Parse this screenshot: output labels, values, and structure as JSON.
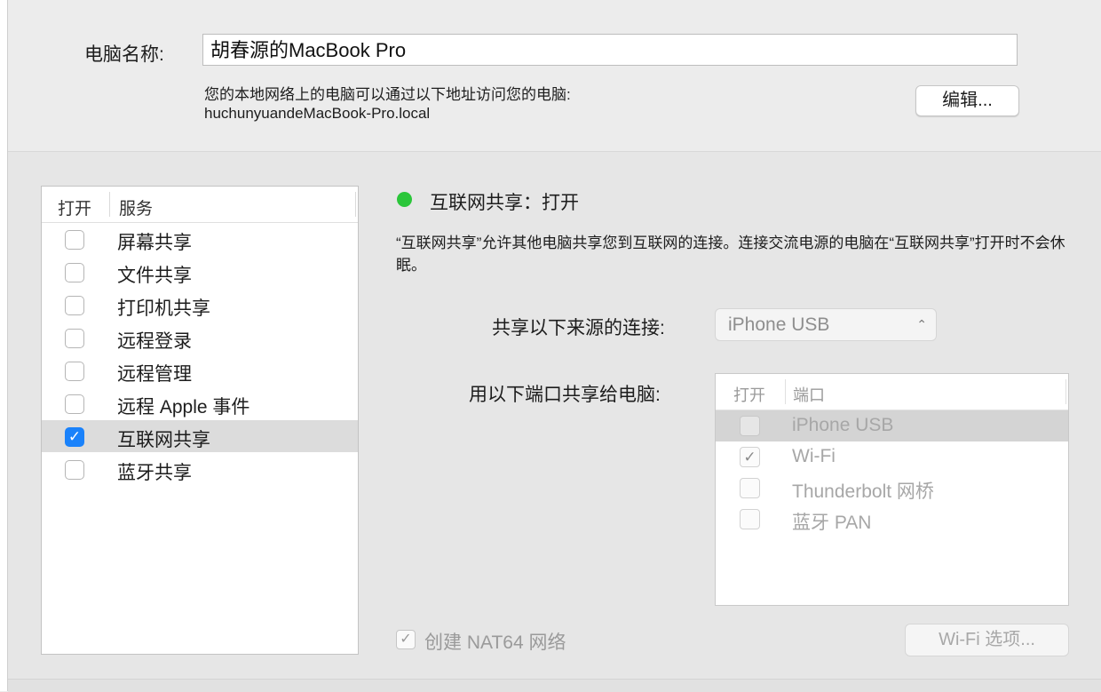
{
  "computer_name": {
    "label": "电脑名称:",
    "value": "胡春源的MacBook Pro",
    "info_line1": "您的本地网络上的电脑可以通过以下地址访问您的电脑:",
    "info_line2": "huchunyuandeMacBook-Pro.local",
    "edit_button": "编辑..."
  },
  "services": {
    "header_on": "打开",
    "header_service": "服务",
    "items": [
      {
        "label": "屏幕共享",
        "checked": false
      },
      {
        "label": "文件共享",
        "checked": false
      },
      {
        "label": "打印机共享",
        "checked": false
      },
      {
        "label": "远程登录",
        "checked": false
      },
      {
        "label": "远程管理",
        "checked": false
      },
      {
        "label": "远程 Apple 事件",
        "checked": false
      },
      {
        "label": "互联网共享",
        "checked": true,
        "selected": true
      },
      {
        "label": "蓝牙共享",
        "checked": false
      }
    ]
  },
  "detail": {
    "status": "互联网共享：打开",
    "status_color": "#2bc63a",
    "description": "“互联网共享”允许其他电脑共享您到互联网的连接。连接交流电源的电脑在“互联网共享”打开时不会休眠。",
    "source_label": "共享以下来源的连接:",
    "source_value": "iPhone USB",
    "ports_label": "用以下端口共享给电脑:",
    "ports_header_on": "打开",
    "ports_header_port": "端口",
    "ports": [
      {
        "label": "iPhone USB",
        "checked": false,
        "selected": true
      },
      {
        "label": "Wi-Fi",
        "checked": true
      },
      {
        "label": "Thunderbolt 网桥",
        "checked": false
      },
      {
        "label": "蓝牙 PAN",
        "checked": false
      }
    ],
    "nat64_label": "创建 NAT64 网络",
    "nat64_checked": true,
    "wifi_options_button": "Wi-Fi 选项..."
  },
  "icons": {
    "check": "✓",
    "chevron_updown": "⇕"
  }
}
